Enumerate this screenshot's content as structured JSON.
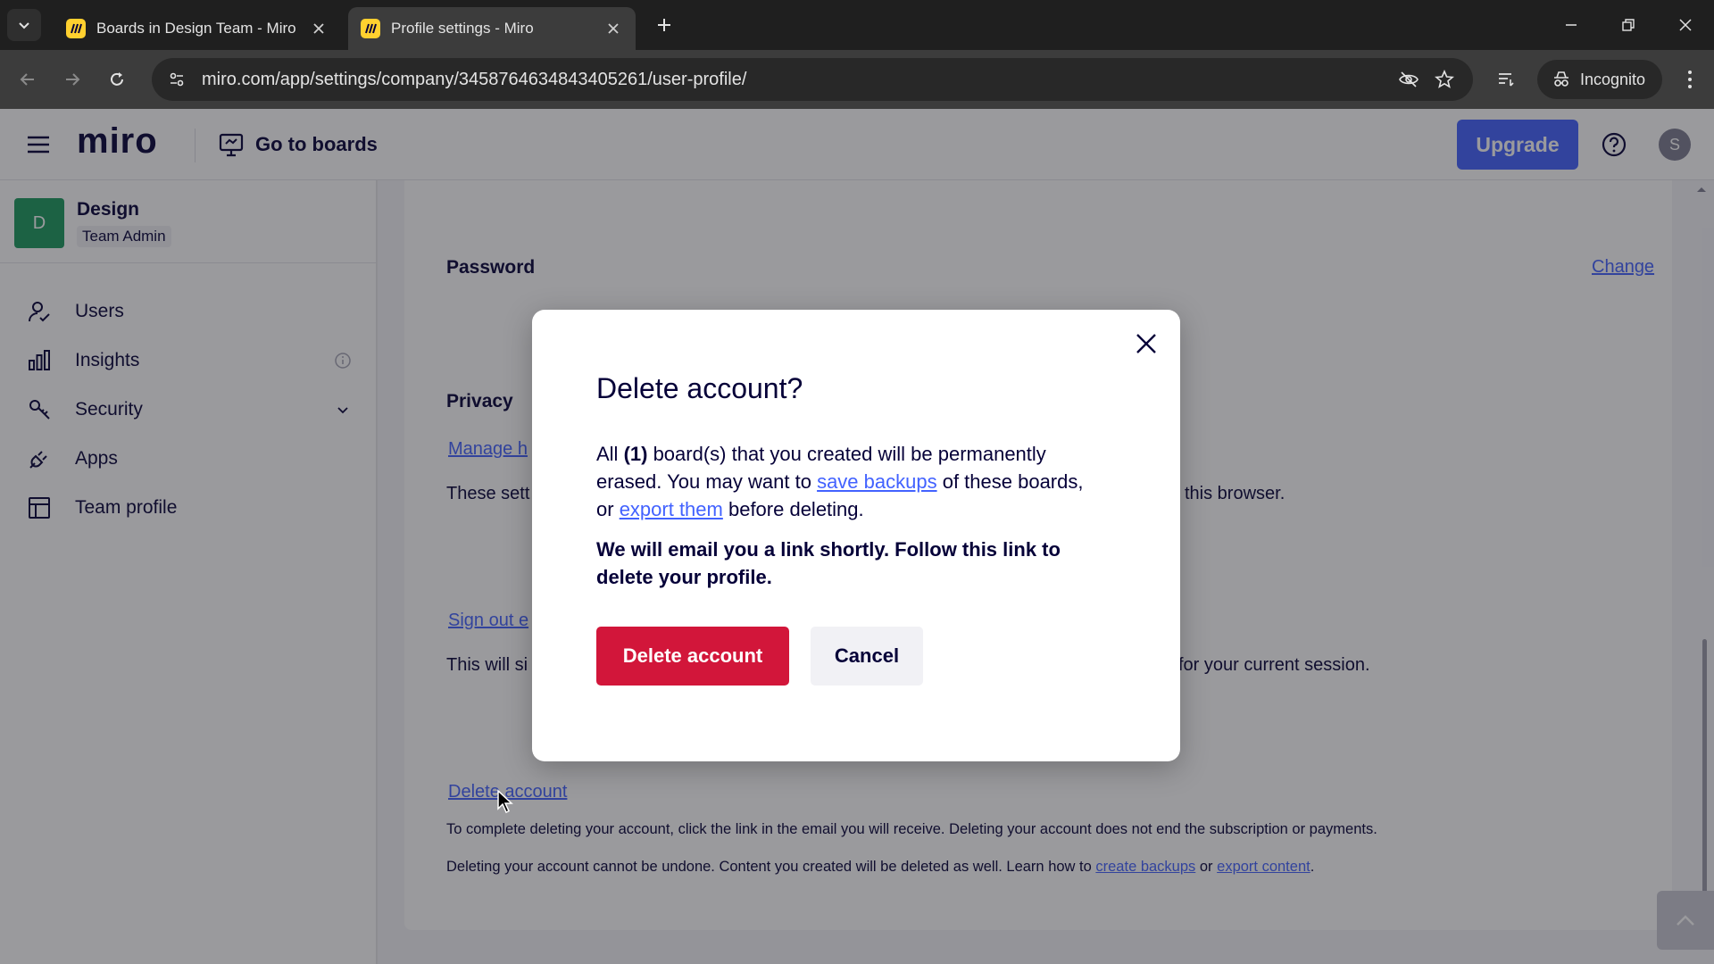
{
  "browser": {
    "tabs": [
      {
        "title": "Boards in Design Team - Miro",
        "active": false
      },
      {
        "title": "Profile settings - Miro",
        "active": true
      }
    ],
    "url": "miro.com/app/settings/company/3458764634843405261/user-profile/",
    "incognito_label": "Incognito"
  },
  "header": {
    "logo": "miro",
    "go_to_boards": "Go to boards",
    "upgrade": "Upgrade",
    "avatar_initial": "S"
  },
  "sidebar": {
    "team_initial": "D",
    "team_name": "Design",
    "team_role": "Team Admin",
    "items": [
      {
        "label": "Users",
        "icon": "user-icon"
      },
      {
        "label": "Insights",
        "icon": "bar-chart-icon"
      },
      {
        "label": "Security",
        "icon": "key-icon"
      },
      {
        "label": "Apps",
        "icon": "plug-icon"
      },
      {
        "label": "Team profile",
        "icon": "layout-icon"
      }
    ]
  },
  "main": {
    "password_title": "Password",
    "password_change": "Change",
    "privacy_title": "Privacy",
    "manage_link": "Manage h",
    "these_settings_text": "These sett",
    "this_browser_text": "this browser.",
    "sign_out_link": "Sign out e",
    "this_will_text": "This will si",
    "current_session_text": "for your current session.",
    "delete_account_link": "Delete account",
    "delete_note_1": "To complete deleting your account, click the link in the email you will receive. Deleting your account does not end the subscription or payments.",
    "delete_note_2_prefix": "Deleting your account cannot be undone. Content you created will be deleted as well. Learn how to ",
    "create_backups_link": "create backups",
    "or_text": " or ",
    "export_content_link": "export content",
    "period": "."
  },
  "modal": {
    "title": "Delete account?",
    "p1_a": "All ",
    "p1_count": "(1)",
    "p1_b": " board(s) that you created will be permanently erased. You may want to ",
    "save_backups_link": "save backups",
    "p1_c": " of these boards, or ",
    "export_them_link": "export them",
    "p1_d": " before deleting.",
    "p2": "We will email you a link shortly. Follow this link to delete your profile.",
    "delete_button": "Delete account",
    "cancel_button": "Cancel"
  }
}
